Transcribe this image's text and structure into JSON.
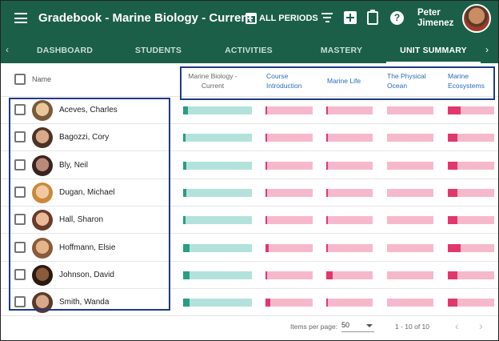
{
  "header": {
    "title": "Gradebook - Marine Biology - Current",
    "periods_label": "ALL PERIODS",
    "user_name": "Peter Jimenez",
    "bg_color": "#1b5f49"
  },
  "tabs": [
    {
      "label": "DASHBOARD"
    },
    {
      "label": "STUDENTS"
    },
    {
      "label": "ACTIVITIES"
    },
    {
      "label": "MASTERY"
    },
    {
      "label": "UNIT SUMMARY",
      "active": true
    }
  ],
  "table": {
    "name_header": "Name",
    "columns": [
      {
        "label": "Marine Biology - Current"
      },
      {
        "label": "Course Introduction"
      },
      {
        "label": "Marine Life"
      },
      {
        "label": "The Physical Ocean"
      },
      {
        "label": "Marine Ecosystems"
      }
    ],
    "students": [
      {
        "name": "Aceves, Charles",
        "progress": [
          0.07,
          0.03,
          0.03,
          0.0,
          0.27
        ]
      },
      {
        "name": "Bagozzi, Cory",
        "progress": [
          0.03,
          0.03,
          0.03,
          0.0,
          0.2
        ]
      },
      {
        "name": "Bly, Neil",
        "progress": [
          0.05,
          0.03,
          0.03,
          0.0,
          0.2
        ]
      },
      {
        "name": "Dugan, Michael",
        "progress": [
          0.05,
          0.03,
          0.03,
          0.0,
          0.2
        ]
      },
      {
        "name": "Hall, Sharon",
        "progress": [
          0.03,
          0.03,
          0.03,
          0.0,
          0.2
        ]
      },
      {
        "name": "Hoffmann, Elsie",
        "progress": [
          0.09,
          0.07,
          0.03,
          0.0,
          0.27
        ]
      },
      {
        "name": "Johnson, David",
        "progress": [
          0.09,
          0.03,
          0.13,
          0.0,
          0.2
        ]
      },
      {
        "name": "Smith, Wanda",
        "progress": [
          0.09,
          0.1,
          0.03,
          0.0,
          0.2
        ]
      }
    ]
  },
  "colors": {
    "teal_track": "#b3e2dc",
    "teal_fill": "#2a9d83",
    "pink_track": "#f6b9cb",
    "pink_fill": "#e2376d",
    "link_blue": "#2a6db8",
    "highlight_border": "#1f3b86"
  },
  "pagination": {
    "items_per_page_label": "Items per page:",
    "items_per_page": "50",
    "range": "1 - 10 of 10"
  }
}
